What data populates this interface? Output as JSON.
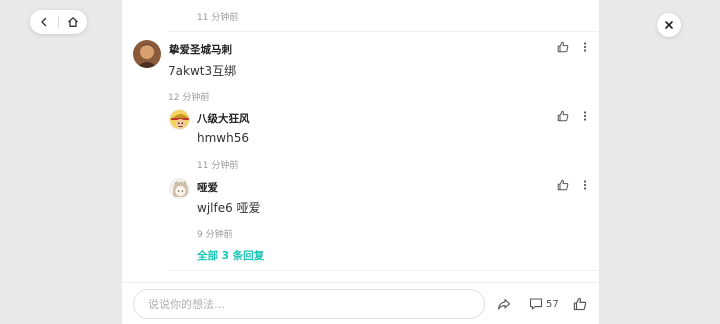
{
  "nav": {
    "back_icon": "chevron-left-icon",
    "home_icon": "home-icon",
    "close_icon": "close-icon"
  },
  "top_time": "11 分钟前",
  "comment": {
    "username": "挚爱圣城马刺",
    "text": "7akwt3互绑",
    "time": "12 分钟前"
  },
  "replies": [
    {
      "username": "八级大狂风",
      "text": "hmwh56",
      "time": "11 分钟前"
    },
    {
      "username": "哑爱",
      "text": "wjlfe6 哑爱",
      "time": "9 分钟前"
    }
  ],
  "all_replies_label": "全部 3 条回复",
  "bottom_bar": {
    "placeholder": "说说你的想法…",
    "comment_count": "57"
  },
  "colors": {
    "accent": "#19c6b5",
    "panel": "#ffffff",
    "backdrop": "#e9e9e9"
  }
}
